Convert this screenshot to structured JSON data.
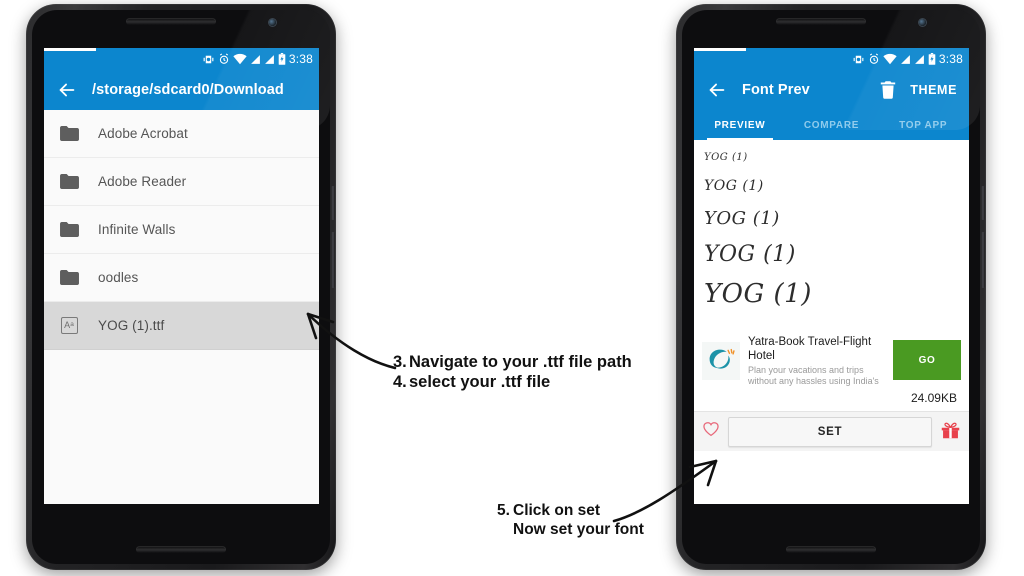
{
  "status_bar": {
    "time": "3:38",
    "icons": [
      "vibrate-icon",
      "alarm-icon",
      "wifi-icon",
      "signal-icon",
      "signal-icon",
      "battery-icon"
    ]
  },
  "left_phone": {
    "name": "file-browser-phone",
    "appbar": {
      "back_icon": "arrow-left-icon",
      "title": "/storage/sdcard0/Download"
    },
    "files": [
      {
        "name": "Adobe Acrobat",
        "icon": "folder-icon",
        "selected": false
      },
      {
        "name": "Adobe Reader",
        "icon": "folder-icon",
        "selected": false
      },
      {
        "name": "Infinite Walls",
        "icon": "folder-icon",
        "selected": false
      },
      {
        "name": "oodles",
        "icon": "folder-icon",
        "selected": false
      },
      {
        "name": "YOG (1).ttf",
        "icon": "font-file-icon",
        "selected": true
      }
    ]
  },
  "right_phone": {
    "name": "font-preview-phone",
    "appbar": {
      "back_icon": "arrow-left-icon",
      "title": "Font Prev",
      "delete_icon": "trash-icon",
      "theme_label": "THEME"
    },
    "tabs": [
      {
        "label": "PREVIEW",
        "active": true
      },
      {
        "label": "COMPARE",
        "active": false
      },
      {
        "label": "TOP APP",
        "active": false
      }
    ],
    "preview_lines": [
      {
        "text": "YOG (1)",
        "size": 10
      },
      {
        "text": "YOG (1)",
        "size": 14
      },
      {
        "text": "YOG (1)",
        "size": 18
      },
      {
        "text": "YOG (1)",
        "size": 22
      },
      {
        "text": "YOG (1)",
        "size": 26
      }
    ],
    "ad": {
      "logo_icon": "yatra-logo-icon",
      "title": "Yatra-Book Travel-Flight Hotel",
      "subtitle": "Plan your vacations and trips without any hassles using India's",
      "cta_label": "GO",
      "size_label": "24.09KB"
    },
    "bottom_bar": {
      "favorite_icon": "heart-icon",
      "set_label": "SET",
      "gift_icon": "gift-icon"
    }
  },
  "annotations": [
    {
      "name": "annotation-step-3-4",
      "lines": [
        {
          "num": "3.",
          "text": "Navigate to your .ttf file path"
        },
        {
          "num": "4.",
          "text": "select your .ttf file"
        }
      ]
    },
    {
      "name": "annotation-step-5",
      "lines": [
        {
          "num": "5.",
          "text": "Click on set"
        },
        {
          "num": "",
          "text": "Now set your font"
        }
      ]
    }
  ],
  "colors": {
    "primary_blue": "#0C86CE",
    "go_green": "#4A9A22",
    "accent_red": "#E8414C",
    "selected_row": "#d8d8d8"
  }
}
